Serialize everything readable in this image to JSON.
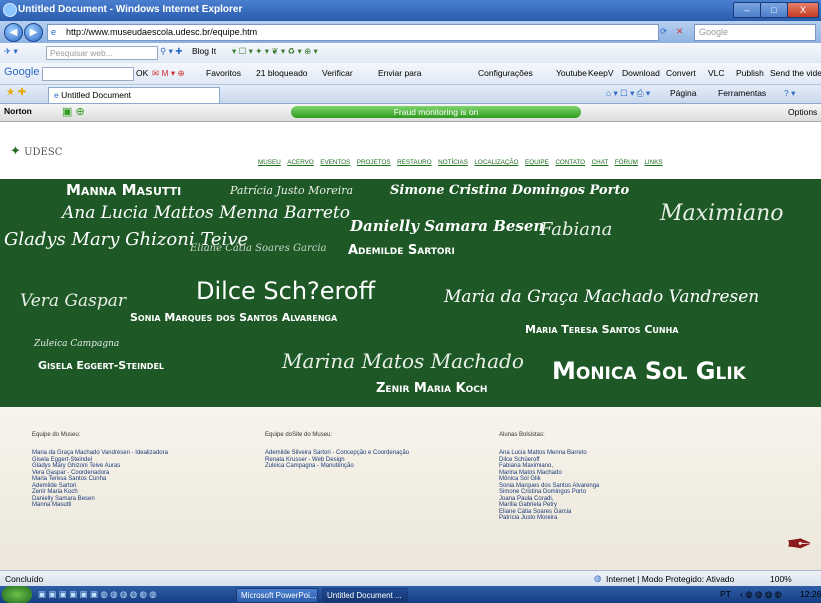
{
  "window": {
    "title": "Untitled Document - Windows Internet Explorer",
    "min": "–",
    "max": "□",
    "close": "X"
  },
  "address": {
    "url": "http://www.museudaescola.udesc.br/equipe.htm",
    "search_placeholder": "Google"
  },
  "toolbar1": {
    "search_placeholder": "Pesquisar web...",
    "blogit": "Blog It"
  },
  "toolbar2": {
    "google": "Google",
    "ok": "OK",
    "favoritos": "Favoritos",
    "bloqueado": "21 bloqueado",
    "verificar": "Verificar",
    "enviar": "Enviar para",
    "config": "Configurações",
    "youtube": "Youtube",
    "keepv": "KeepV",
    "download": "Download",
    "convert": "Convert",
    "vlc": "VLC",
    "publish": "Publish",
    "send_video": "Send the video"
  },
  "tabs": {
    "active": "Untitled Document",
    "pagina": "Página",
    "ferramentas": "Ferramentas"
  },
  "norton": {
    "brand": "Norton",
    "fraud": "Fraud monitoring is on",
    "options": "Options"
  },
  "site": {
    "logo": "UDESC",
    "nav": [
      "MUSEU",
      "ACERVO",
      "EVENTOS",
      "PROJETOS",
      "RESTAURO",
      "NOTÍCIAS",
      "LOCALIZAÇÃO",
      "EQUIPE",
      "CONTATO",
      "CHAT",
      "FÓRUM",
      "LINKS"
    ],
    "chalk": [
      "Manna Masutti",
      "Patrícia Justo Moreira",
      "Simone Cristina Domingos Porto",
      "Ana Lucia Mattos Menna Barreto",
      "Danielly Samara Besen",
      "Fabiana",
      "Maximiano",
      "Gladys Mary Ghizoni Teive",
      "Eliane Cátia Soares Garcia",
      "Ademilde Sartori",
      "Vera Gaspar",
      "Dilce Sch?eroff",
      "Maria da Graça Machado Vandresen",
      "Sonia Marques dos Santos Alvarenga",
      "Maria Teresa Santos Cunha",
      "Zuleica Campagna",
      "Gisela Eggert-Steindel",
      "Marina Matos Machado",
      "Zenir Maria Koch",
      "Monica Sol Glik"
    ],
    "col1": {
      "head": "Equipe do Museu:",
      "lines": [
        "Maria da Graça Machado Vandresen - Idealizadora",
        "Gisela Eggert-Steindel",
        "Gladys Mary Ghizoni Teive Auras",
        "Vera Gaspar - Coordenadora",
        "Maria Teresa Santos Cunha",
        "Ademilde Sartori",
        "Zenir Maria Koch",
        "Danielly Samara Besen",
        "Manna Masutti"
      ]
    },
    "col2": {
      "head": "Equipe doSite do Museu:",
      "lines": [
        "Ademilde Silveira Sartori - Concepção e Coordenação",
        "Renata Krusser - Web Design",
        "Zuleica Campagna - Manutenção"
      ]
    },
    "col3": {
      "head": "Alunas Bolsistas:",
      "lines": [
        "Ana Lucia Mattos Menna Barreto",
        "Dilce Schüeroff",
        "Fabiana Maximiano,",
        "Marina Matos Machado",
        "Mônica Sol Glik",
        "Sonia Marques dos Santos Alvarenga",
        "Simone Cristina Domingos Porto",
        "Joana Paula Coradi,",
        "Marília Gabriela Petry",
        "Eliane Cátia Soares Garcia",
        "Patrícia Justo Moreira"
      ]
    }
  },
  "status": {
    "left": "Concluído",
    "zone": "Internet | Modo Protegido: Ativado",
    "zoom": "100%"
  },
  "taskbar": {
    "btn1": "Microsoft PowerPoi...",
    "btn2": "Untitled Document ...",
    "lang": "PT",
    "clock": "12:26"
  }
}
